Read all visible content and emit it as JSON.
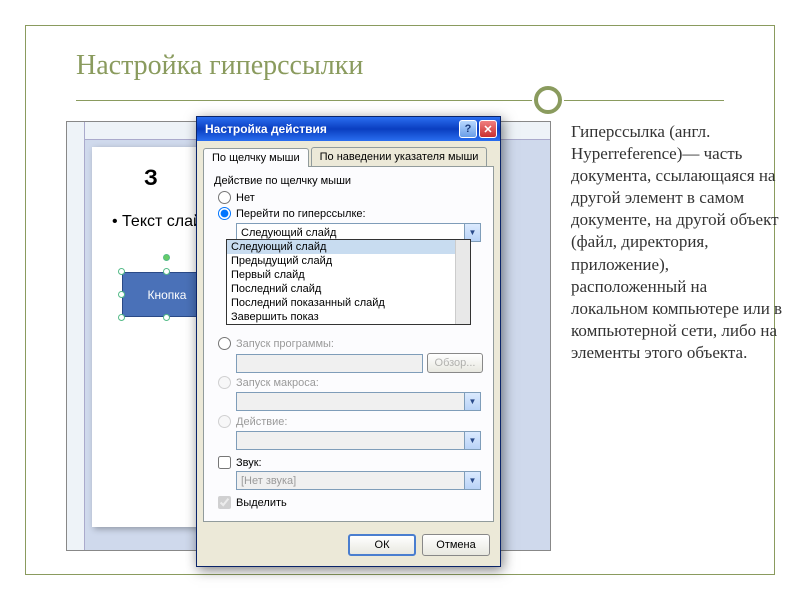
{
  "slide": {
    "title": "Настройка гиперссылки",
    "ppt_heading": "З",
    "ppt_bullet": "Текст слайд",
    "shape_label": "Кнопка"
  },
  "dialog": {
    "title": "Настройка действия",
    "tabs": {
      "click": "По щелчку мыши",
      "hover": "По наведении указателя мыши"
    },
    "group_label": "Действие по щелчку мыши",
    "radios": {
      "none": "Нет",
      "hyperlink": "Перейти по гиперссылке:",
      "program": "Запуск программы:",
      "macro": "Запуск макроса:",
      "action": "Действие:"
    },
    "combo_selected": "Следующий слайд",
    "dropdown": [
      "Следующий слайд",
      "Предыдущий слайд",
      "Первый слайд",
      "Последний слайд",
      "Последний показанный слайд",
      "Завершить показ"
    ],
    "browse": "Обзор...",
    "sound_check": "Звук:",
    "sound_value": "[Нет звука]",
    "highlight_check": "Выделить",
    "ok": "ОК",
    "cancel": "Отмена"
  },
  "description": "Гиперссылка (англ. Hyperreference)— часть документа, ссылающаяся на другой элемент в самом документе, на другой объект (файл, директория, приложение), расположенный на локальном компьютере или в компьютерной сети, либо на элементы этого объекта."
}
